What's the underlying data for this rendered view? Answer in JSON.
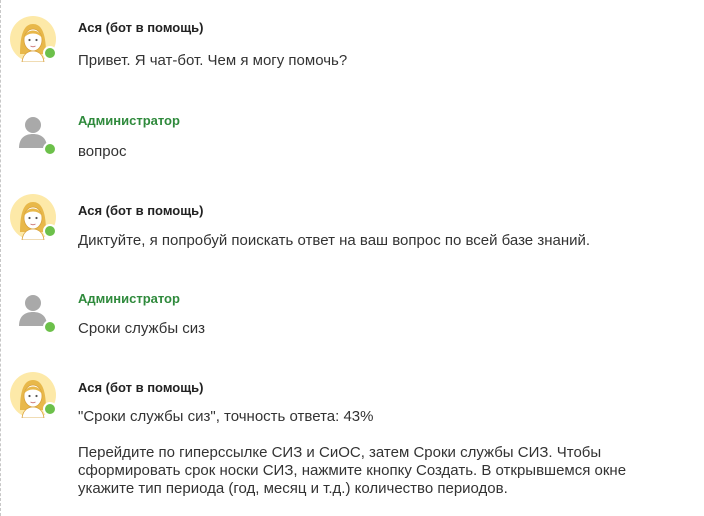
{
  "chat": {
    "messages": [
      {
        "sender": "Ася (бот в помощь)",
        "role": "bot",
        "paragraphs": [
          "Привет. Я чат-бот. Чем я могу помочь?"
        ]
      },
      {
        "sender": "Администратор",
        "role": "admin",
        "paragraphs": [
          "вопрос"
        ]
      },
      {
        "sender": "Ася (бот в помощь)",
        "role": "bot",
        "paragraphs": [
          "Диктуйте, я попробуй поискать ответ на ваш вопрос по всей базе знаний."
        ]
      },
      {
        "sender": "Администратор",
        "role": "admin",
        "paragraphs": [
          "Сроки службы сиз"
        ]
      },
      {
        "sender": "Ася (бот в помощь)",
        "role": "bot",
        "paragraphs": [
          "\"Сроки службы сиз\", точность ответа: 43%",
          "Перейдите по гиперссылке СИЗ и СиОС, затем Сроки службы СИЗ. Чтобы сформировать срок носки СИЗ, нажмите кнопку Создать. В открывшемся окне укажите тип периода (год, месяц и т.д.) количество периодов."
        ]
      }
    ]
  },
  "colors": {
    "admin_name": "#2f8a3c",
    "online_status": "#6cc04a",
    "bot_avatar_bg": "#fde9a8"
  },
  "icons": {
    "bot_avatar": "female-assistant-avatar-icon",
    "admin_avatar": "default-user-avatar-icon",
    "status": "online-status-icon"
  }
}
